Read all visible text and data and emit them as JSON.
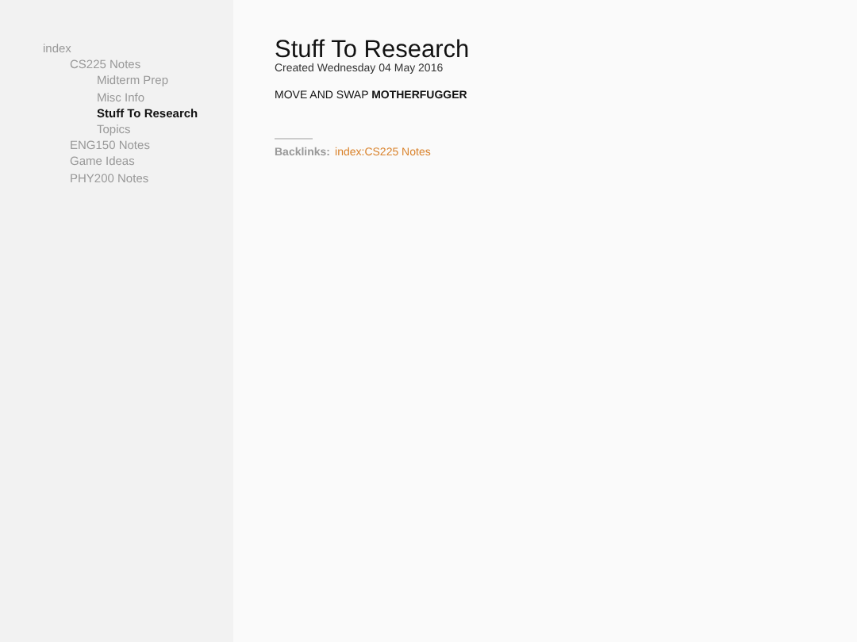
{
  "sidebar": {
    "tree": [
      {
        "label": "index",
        "selected": false,
        "children": [
          {
            "label": "CS225 Notes",
            "selected": false,
            "children": [
              {
                "label": "Midterm Prep",
                "selected": false
              },
              {
                "label": "Misc Info",
                "selected": false
              },
              {
                "label": "Stuff To Research",
                "selected": true
              },
              {
                "label": "Topics",
                "selected": false
              }
            ]
          },
          {
            "label": "ENG150 Notes",
            "selected": false
          },
          {
            "label": "Game Ideas",
            "selected": false
          },
          {
            "label": "PHY200 Notes",
            "selected": false
          }
        ]
      }
    ]
  },
  "page": {
    "title": "Stuff To Research",
    "created": "Created Wednesday 04 May 2016",
    "body": "MOVE AND SWAP **MOTHERFUGGER**",
    "backlinks_label": "Backlinks:",
    "backlinks": [
      "index:CS225 Notes"
    ]
  }
}
